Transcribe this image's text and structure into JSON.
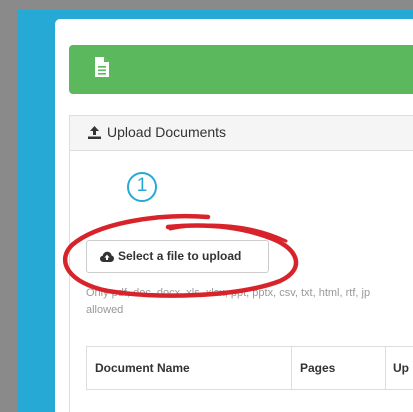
{
  "panel": {
    "title": "Upload Documents"
  },
  "step": {
    "number": "1"
  },
  "upload_button": {
    "label": "Select a file to upload"
  },
  "help": {
    "line1": "Only pdf, doc, docx, xls, xlsx, ppt, pptx, csv, txt, html, rtf, jp",
    "line2": "allowed"
  },
  "table": {
    "columns": [
      "Document Name",
      "Pages",
      "Up"
    ]
  },
  "colors": {
    "accent_blue": "#27a9d6",
    "header_green": "#5cb85c",
    "annotation_red": "#d8232a"
  },
  "icons": {
    "header": "document-icon",
    "panel": "upload-icon",
    "button": "cloud-upload-icon"
  }
}
